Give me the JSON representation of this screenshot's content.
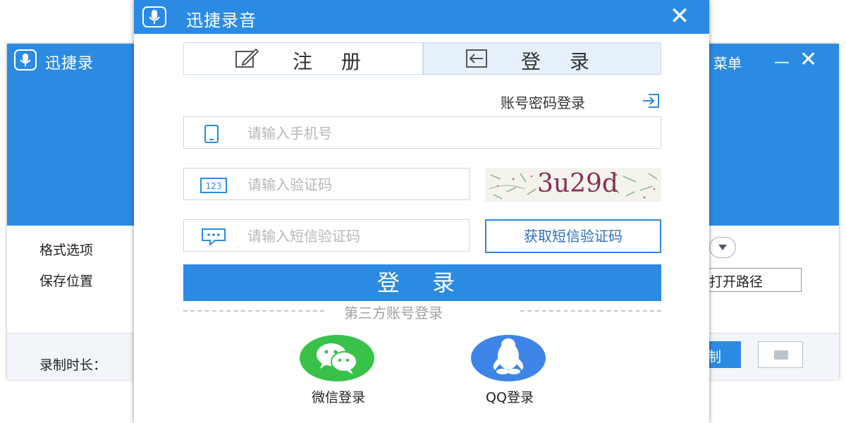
{
  "background_window": {
    "title": "迅捷录",
    "menu_fragment": "菜单",
    "minimize_glyph": "—",
    "close_glyph": "✕",
    "format_label": "格式选项",
    "save_label": "保存位置",
    "open_path_label": "打开路径",
    "duration_label": "录制时长：",
    "record_button_fragment": "制"
  },
  "dialog": {
    "title": "迅捷录音",
    "close_glyph": "✕",
    "tabs": [
      {
        "label": "注 册",
        "icon": "edit-icon"
      },
      {
        "label": "登 录",
        "icon": "login-arrow-icon"
      }
    ],
    "account_login_link": "账号密码登录",
    "phone_field": {
      "placeholder": "请输入手机号",
      "value": "",
      "icon": "phone-icon"
    },
    "captcha_field": {
      "placeholder": "请输入验证码",
      "value": "",
      "icon": "number-123-icon"
    },
    "captcha_image_text": "3u29d",
    "sms_field": {
      "placeholder": "请输入短信验证码",
      "value": "",
      "icon": "message-icon"
    },
    "get_sms_button": "获取短信验证码",
    "login_button": "登 录",
    "third_party_label": "第三方账号登录",
    "wechat_label": "微信登录",
    "qq_label": "QQ登录"
  },
  "colors": {
    "primary": "#2b8be3",
    "wechat": "#38c24a",
    "qq": "#3d84e6",
    "captcha_text": "#8a2f57"
  }
}
